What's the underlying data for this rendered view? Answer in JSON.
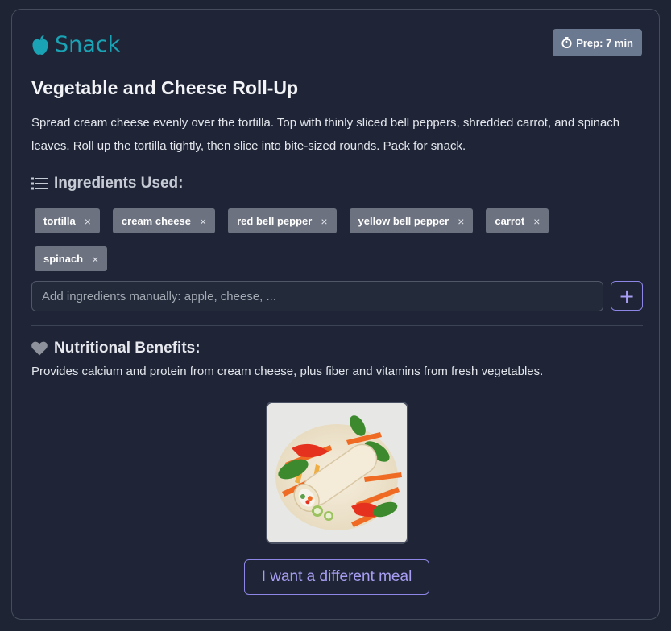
{
  "meal": {
    "type": "Snack",
    "type_icon": "apple-icon",
    "prep_label": "Prep: 7 min",
    "prep_icon": "stopwatch-icon",
    "title": "Vegetable and Cheese Roll-Up",
    "description": "Spread cream cheese evenly over the tortilla. Top with thinly sliced bell peppers, shredded carrot, and spinach leaves. Roll up the tortilla tightly, then slice into bite-sized rounds. Pack for snack."
  },
  "ingredients": {
    "heading": "Ingredients Used:",
    "icon": "list-icon",
    "items": [
      "tortilla",
      "cream cheese",
      "red bell pepper",
      "yellow bell pepper",
      "carrot",
      "spinach"
    ],
    "remove_glyph": "×",
    "input_placeholder": "Add ingredients manually: apple, cheese, ...",
    "add_label": "+"
  },
  "nutrition": {
    "heading": "Nutritional Benefits:",
    "icon": "heart-icon",
    "text": "Provides calcium and protein from cream cheese, plus fiber and vitamins from fresh vegetables."
  },
  "actions": {
    "different_meal": "I want a different meal"
  },
  "colors": {
    "background": "#1e2433",
    "accent_teal": "#1aa3b5",
    "accent_purple": "#a79df2",
    "badge_gray": "#6a7890",
    "chip_gray": "#6c7280"
  }
}
